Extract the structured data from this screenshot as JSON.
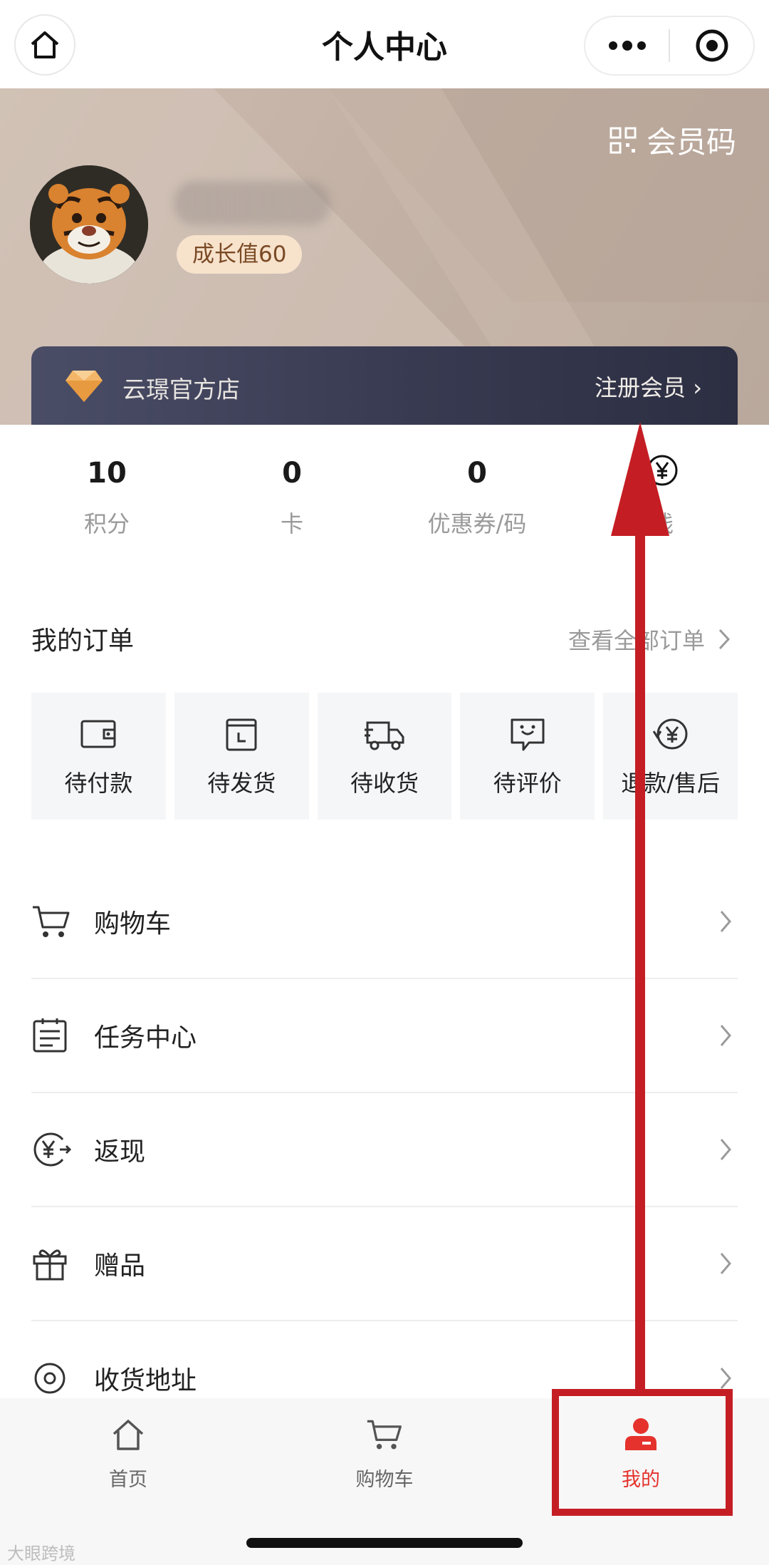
{
  "titlebar": {
    "title": "个人中心"
  },
  "header": {
    "member_code_label": "会员码",
    "growth_label": "成长值60",
    "store_name": "云璟官方店",
    "register_label": "注册会员 ›"
  },
  "stats": [
    {
      "value": "10",
      "label": "积分"
    },
    {
      "value": "0",
      "label": "卡"
    },
    {
      "value": "0",
      "label": "优惠券/码"
    },
    {
      "value": "",
      "label": "钱"
    }
  ],
  "orders": {
    "title": "我的订单",
    "view_all": "查看全部订单",
    "tiles": [
      {
        "label": "待付款",
        "icon": "wallet-icon"
      },
      {
        "label": "待发货",
        "icon": "pending-ship-icon"
      },
      {
        "label": "待收货",
        "icon": "delivery-truck-icon"
      },
      {
        "label": "待评价",
        "icon": "review-chat-icon"
      },
      {
        "label": "退款/售后",
        "icon": "refund-icon"
      }
    ]
  },
  "menu": [
    {
      "label": "购物车",
      "icon": "cart-icon"
    },
    {
      "label": "任务中心",
      "icon": "task-list-icon"
    },
    {
      "label": "返现",
      "icon": "cashback-icon"
    },
    {
      "label": "赠品",
      "icon": "gift-icon"
    },
    {
      "label": "收货地址",
      "icon": "location-icon"
    }
  ],
  "tabbar": [
    {
      "label": "首页",
      "icon": "home-icon"
    },
    {
      "label": "购物车",
      "icon": "cart-icon"
    },
    {
      "label": "我的",
      "icon": "user-icon"
    }
  ],
  "colors": {
    "accent": "#e5322d",
    "annotation": "#c41e24",
    "vip_card": "#383a51",
    "growth_badge": "#f7e2cc"
  },
  "watermark": "大眼跨境"
}
